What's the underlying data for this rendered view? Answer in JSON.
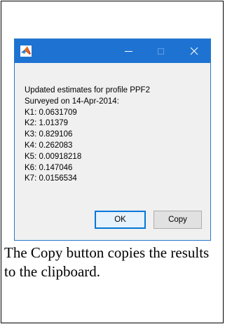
{
  "dialog": {
    "title": "",
    "icon": "matlab-icon",
    "controls": {
      "minimize": "minimize-icon",
      "maximize": "maximize-icon",
      "close": "close-icon"
    },
    "message_lines": [
      "Updated estimates for profile PPF2",
      "Surveyed on 14-Apr-2014:",
      "K1: 0.0631709",
      "K2: 1.01379",
      "K3: 0.829106",
      "K4: 0.262083",
      "K5: 0.00918218",
      "K6: 0.147046",
      "K7: 0.0156534"
    ],
    "buttons": {
      "ok_label": "OK",
      "copy_label": "Copy"
    }
  },
  "caption": "The Copy button copies the results to the clipboard.",
  "colors": {
    "titlebar": "#1e73d2",
    "dialog_background": "#f0f0f0",
    "ok_border": "#0078d7"
  }
}
